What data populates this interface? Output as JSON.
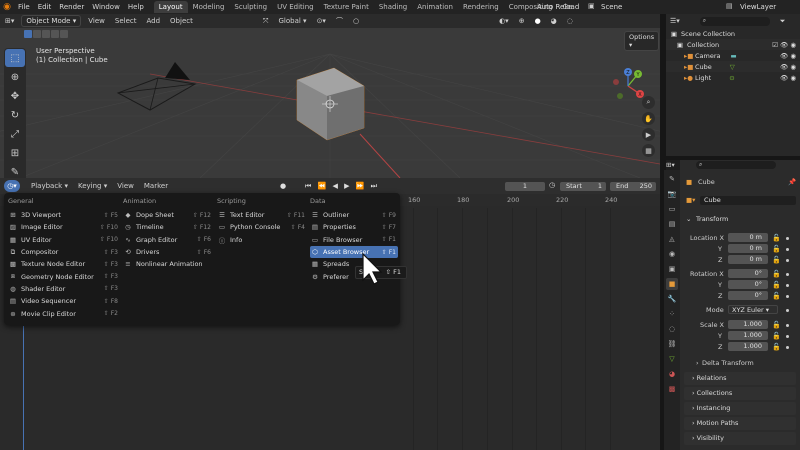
{
  "topbar": {
    "menu": [
      "File",
      "Edit",
      "Render",
      "Window",
      "Help"
    ],
    "workspaces": [
      "Layout",
      "Modeling",
      "Sculpting",
      "UV Editing",
      "Texture Paint",
      "Shading",
      "Animation",
      "Rendering",
      "Compositing",
      "Ge"
    ],
    "active_workspace": "Layout",
    "auto_reload": "Auto Reload",
    "scene": "Scene",
    "view_layer": "ViewLayer"
  },
  "viewport": {
    "mode": "Object Mode",
    "menus": [
      "View",
      "Select",
      "Add",
      "Object"
    ],
    "transform": "Global",
    "options": "Options",
    "info_line1": "User Perspective",
    "info_line2": "(1) Collection | Cube",
    "gizmo": {
      "x": "X",
      "y": "Y",
      "z": "Z"
    }
  },
  "outliner": {
    "items": [
      {
        "label": "Scene Collection",
        "icon": "scene-collection-icon"
      },
      {
        "label": "Collection",
        "icon": "collection-icon"
      },
      {
        "label": "Camera",
        "icon": "camera-icon"
      },
      {
        "label": "Cube",
        "icon": "mesh-icon"
      },
      {
        "label": "Light",
        "icon": "light-icon"
      }
    ]
  },
  "timeline": {
    "menus": [
      "Playback",
      "Keying",
      "View",
      "Marker"
    ],
    "current_frame": "1",
    "start_label": "Start",
    "start": "1",
    "end_label": "End",
    "end": "250",
    "frame_labels": [
      "160",
      "180",
      "200",
      "220",
      "240"
    ]
  },
  "editor_menu": {
    "columns": [
      {
        "title": "General",
        "items": [
          {
            "label": "3D Viewport",
            "shortcut": "⇧ F5",
            "icon": "viewport-icon"
          },
          {
            "label": "Image Editor",
            "shortcut": "⇧ F10",
            "icon": "image-icon"
          },
          {
            "label": "UV Editor",
            "shortcut": "⇧ F10",
            "icon": "uv-icon"
          },
          {
            "label": "Compositor",
            "shortcut": "⇧ F3",
            "icon": "compositor-icon"
          },
          {
            "label": "Texture Node Editor",
            "shortcut": "⇧ F3",
            "icon": "texture-node-icon"
          },
          {
            "label": "Geometry Node Editor",
            "shortcut": "⇧ F3",
            "icon": "geometry-node-icon"
          },
          {
            "label": "Shader Editor",
            "shortcut": "⇧ F3",
            "icon": "shader-icon"
          },
          {
            "label": "Video Sequencer",
            "shortcut": "⇧ F8",
            "icon": "sequencer-icon"
          },
          {
            "label": "Movie Clip Editor",
            "shortcut": "⇧ F2",
            "icon": "clip-icon"
          }
        ]
      },
      {
        "title": "Animation",
        "items": [
          {
            "label": "Dope Sheet",
            "shortcut": "⇧ F12",
            "icon": "dopesheet-icon"
          },
          {
            "label": "Timeline",
            "shortcut": "⇧ F12",
            "icon": "timeline-icon"
          },
          {
            "label": "Graph Editor",
            "shortcut": "⇧ F6",
            "icon": "graph-icon"
          },
          {
            "label": "Drivers",
            "shortcut": "⇧ F6",
            "icon": "drivers-icon"
          },
          {
            "label": "Nonlinear Animation",
            "shortcut": "",
            "icon": "nla-icon"
          }
        ]
      },
      {
        "title": "Scripting",
        "items": [
          {
            "label": "Text Editor",
            "shortcut": "⇧ F11",
            "icon": "text-icon"
          },
          {
            "label": "Python Console",
            "shortcut": "⇧ F4",
            "icon": "console-icon"
          },
          {
            "label": "Info",
            "shortcut": "",
            "icon": "info-icon"
          }
        ]
      },
      {
        "title": "Data",
        "items": [
          {
            "label": "Outliner",
            "shortcut": "⇧ F9",
            "icon": "outliner-icon"
          },
          {
            "label": "Properties",
            "shortcut": "⇧ F7",
            "icon": "properties-icon"
          },
          {
            "label": "File Browser",
            "shortcut": "⇧ F1",
            "icon": "file-browser-icon"
          },
          {
            "label": "Asset Browser",
            "shortcut": "⇧ F1",
            "icon": "asset-browser-icon"
          },
          {
            "label": "Spreads",
            "shortcut": "",
            "icon": "spreadsheet-icon"
          },
          {
            "label": "Preferer",
            "shortcut": "",
            "icon": "preferences-icon"
          }
        ]
      }
    ],
    "highlighted": "Asset Browser",
    "tooltip_partial": "S",
    "tooltip_shortcut": "⇧ F1"
  },
  "properties": {
    "object_name_header": "Cube",
    "object_name": "Cube",
    "transform": "Transform",
    "location_label": "Location X",
    "rotation_label": "Rotation X",
    "scale_label": "Scale X",
    "y": "Y",
    "z": "Z",
    "location": [
      "0 m",
      "0 m",
      "0 m"
    ],
    "rotation": [
      "0°",
      "0°",
      "0°"
    ],
    "scale": [
      "1.000",
      "1.000",
      "1.000"
    ],
    "mode_label": "Mode",
    "mode": "XYZ Euler",
    "delta": "Delta Transform",
    "sections": [
      "Relations",
      "Collections",
      "Instancing",
      "Motion Paths",
      "Visibility"
    ]
  },
  "colors": {
    "accent": "#4772b3",
    "viewport_bg": "#3a3a3a",
    "panel_bg": "#2b2b2b"
  }
}
